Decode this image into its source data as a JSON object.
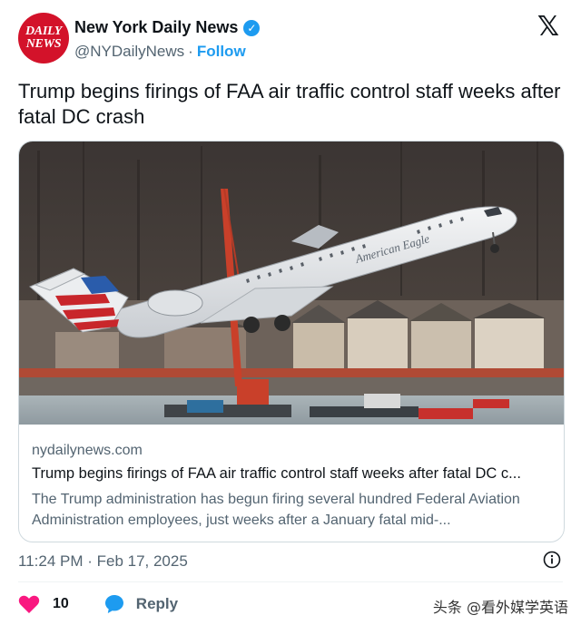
{
  "author": {
    "avatar_text_line1": "DAILY",
    "avatar_text_line2": "NEWS",
    "display_name": "New York Daily News",
    "handle": "@NYDailyNews",
    "separator": "·",
    "follow_label": "Follow"
  },
  "tweet": {
    "text": "Trump begins firings of FAA air traffic control staff weeks after fatal DC crash"
  },
  "card": {
    "image_airline_text": "American Eagle",
    "domain": "nydailynews.com",
    "title": "Trump begins firings of FAA air traffic control staff weeks after fatal DC c...",
    "description": "The Trump administration has begun firing several hundred Federal Aviation Administration employees, just weeks after a January fatal mid-..."
  },
  "meta": {
    "timestamp": "11:24 PM · Feb 17, 2025"
  },
  "actions": {
    "like_count": "10",
    "reply_label": "Reply"
  },
  "watermark": {
    "text": "头条 @看外媒学英语"
  },
  "colors": {
    "accent": "#1d9bf0",
    "like": "#f91880",
    "brand_red": "#d3122a",
    "muted_text": "#536471"
  },
  "icons": [
    "verified-badge-icon",
    "x-logo-icon",
    "info-icon",
    "heart-icon",
    "reply-bubble-icon"
  ]
}
